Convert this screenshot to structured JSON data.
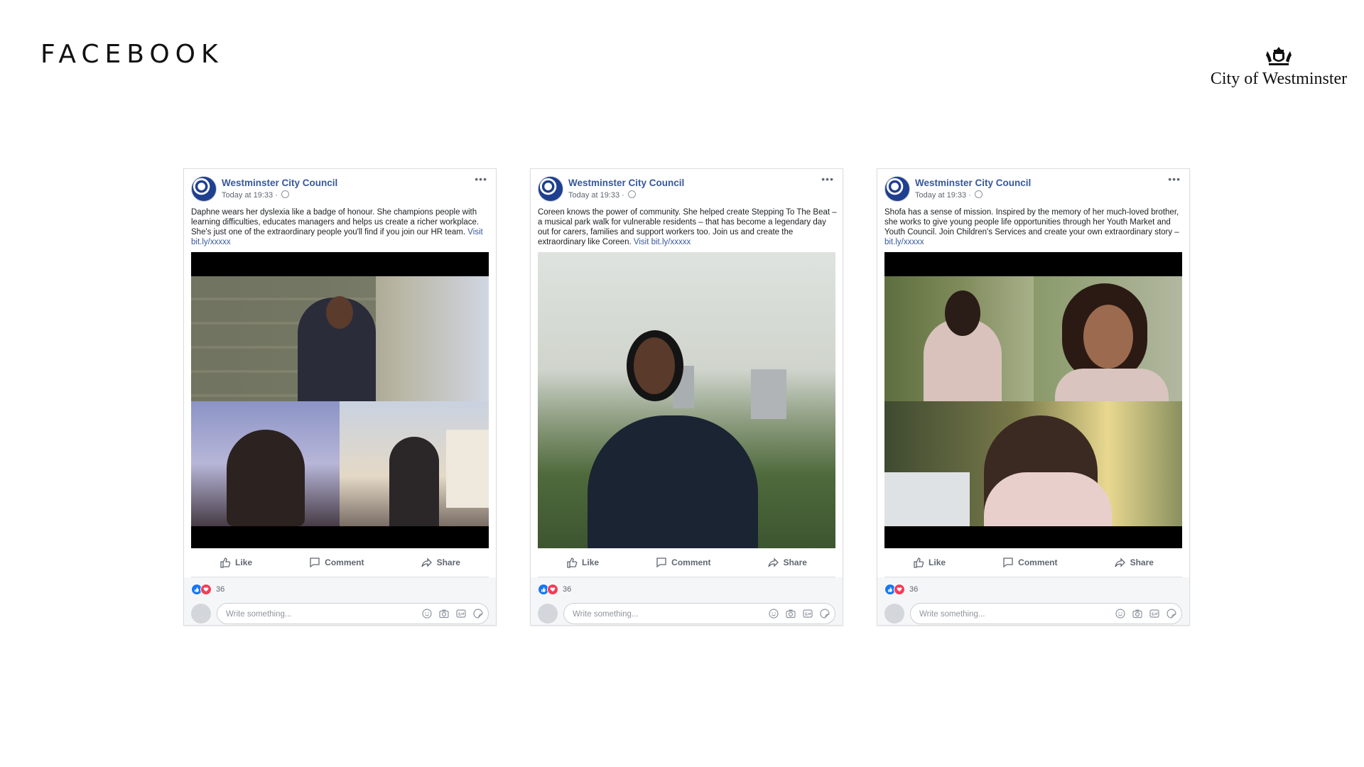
{
  "heading": "FACEBOOK",
  "brand": {
    "name": "City of Westminster",
    "crest_icon": "westminster-crest-icon"
  },
  "colors": {
    "link": "#385898",
    "like": "#1877f2",
    "love": "#f33e58"
  },
  "posts": [
    {
      "page_name": "Westminster City Council",
      "meta": "Today at 19:33 ·",
      "text": "Daphne wears her dyslexia like a badge of honour. She champions people with learning difficulties, educates managers and helps us create a richer workplace. She's just one of the extraordinary people you'll find if you join our HR team.",
      "link_prefix": "Visit",
      "link": "bit.ly/xxxxx",
      "actions": {
        "like": "Like",
        "comment": "Comment",
        "share": "Share"
      },
      "reaction_count": "36",
      "comment_placeholder": "Write something..."
    },
    {
      "page_name": "Westminster City Council",
      "meta": "Today at 19:33 ·",
      "text": "Coreen knows the power of community. She helped create Stepping To The Beat – a musical park walk for vulnerable residents – that has become a legendary day out for carers, families and support workers too. Join us and create the extraordinary like Coreen.",
      "link_prefix": "Visit",
      "link": "bit.ly/xxxxx",
      "actions": {
        "like": "Like",
        "comment": "Comment",
        "share": "Share"
      },
      "reaction_count": "36",
      "comment_placeholder": "Write something..."
    },
    {
      "page_name": "Westminster City Council",
      "meta": "Today at 19:33 ·",
      "text": "Shofa has a sense of mission. Inspired by the memory of her much-loved brother, she works to give young people life opportunities through her Youth Market and Youth Council. Join Children's Services and create your own extraordinary story –",
      "link_prefix": "",
      "link": "bit.ly/xxxxx",
      "actions": {
        "like": "Like",
        "comment": "Comment",
        "share": "Share"
      },
      "reaction_count": "36",
      "comment_placeholder": "Write something..."
    }
  ]
}
